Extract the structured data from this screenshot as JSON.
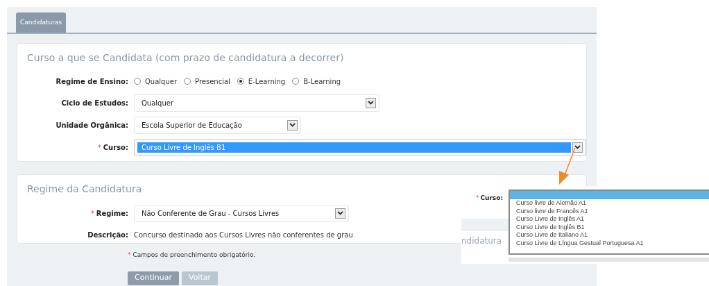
{
  "tabs": [
    {
      "label": "Candidaturas",
      "selected": true
    }
  ],
  "sections": [
    {
      "title": "Curso a que se Candidata (com prazo de candidatura a decorrer)",
      "rows": [
        {
          "kind": "radio",
          "label": "Regime de Ensino:",
          "required": false,
          "options": [
            {
              "label": "Qualquer",
              "selected": false
            },
            {
              "label": "Presencial",
              "selected": false
            },
            {
              "label": "E-Learning",
              "selected": true
            },
            {
              "label": "B-Learning",
              "selected": false
            }
          ]
        },
        {
          "kind": "select",
          "label": "Ciclo de Estudos:",
          "required": false,
          "value": "Qualquer",
          "highlighted": false
        },
        {
          "kind": "select",
          "label": "Unidade Orgânica:",
          "required": false,
          "value": "Escola Superior de Educação",
          "highlighted": false
        },
        {
          "kind": "select",
          "label": "Curso:",
          "required": true,
          "value": "Curso Livre de Inglês B1",
          "highlighted": true
        }
      ]
    },
    {
      "title": "Regime da Candidatura",
      "rows": [
        {
          "kind": "select",
          "label": "Regime:",
          "required": true,
          "value": "Não Conferente de Grau - Cursos Livres",
          "highlighted": false
        },
        {
          "kind": "text",
          "label": "Descrição:",
          "required": false,
          "value": "Concurso destinado aos Cursos Livres não conferentes de grau"
        }
      ]
    }
  ],
  "required_note": {
    "mark": "*",
    "text": "Campos de preenchimento obrigatório."
  },
  "buttons": [
    {
      "label": "Continuar",
      "disabled": false
    },
    {
      "label": "Voltar",
      "disabled": true
    }
  ],
  "inset": {
    "label": "Curso:",
    "required": true,
    "heading_fragment": "ndidatura",
    "blank_option_selected": true,
    "options": [
      {
        "label": "Curso livre de Alemão A1",
        "selected": false
      },
      {
        "label": "Curso livre de Francês A1",
        "selected": false
      },
      {
        "label": "Curso Livre de Inglês A1",
        "selected": false
      },
      {
        "label": "Curso Livre de Inglês B1",
        "selected": false
      },
      {
        "label": "Curso Livre de Italiano A1",
        "selected": false
      },
      {
        "label": "Curso Livre de Língua Gestual Portuguesa A1",
        "selected": false
      }
    ]
  }
}
